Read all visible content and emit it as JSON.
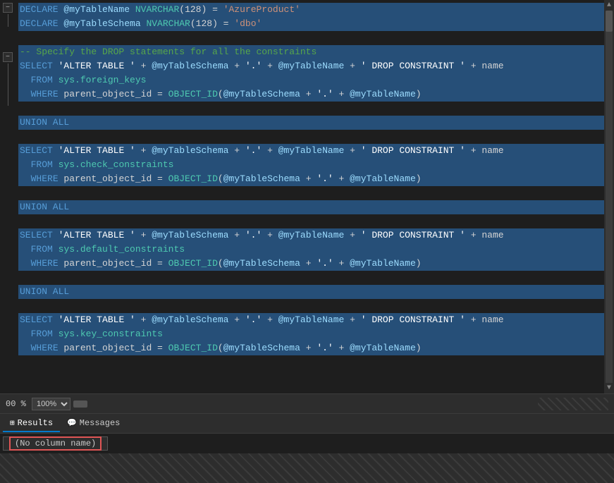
{
  "editor": {
    "lines": [
      {
        "id": 1,
        "selected": true,
        "collapse": true,
        "content": "line1"
      },
      {
        "id": 2,
        "selected": true,
        "collapse": false,
        "content": "line2"
      },
      {
        "id": 3,
        "selected": false,
        "collapse": false,
        "content": "blank1"
      },
      {
        "id": 4,
        "selected": true,
        "collapse": false,
        "content": "comment1"
      },
      {
        "id": 5,
        "selected": true,
        "collapse": true,
        "content": "select1"
      },
      {
        "id": 6,
        "selected": true,
        "collapse": false,
        "content": "from1"
      },
      {
        "id": 7,
        "selected": true,
        "collapse": false,
        "content": "where1"
      },
      {
        "id": 8,
        "selected": false,
        "collapse": false,
        "content": "blank2"
      },
      {
        "id": 9,
        "selected": true,
        "collapse": false,
        "content": "union1"
      },
      {
        "id": 10,
        "selected": false,
        "collapse": false,
        "content": "blank3"
      },
      {
        "id": 11,
        "selected": true,
        "collapse": false,
        "content": "select2"
      },
      {
        "id": 12,
        "selected": true,
        "collapse": false,
        "content": "from2"
      },
      {
        "id": 13,
        "selected": true,
        "collapse": false,
        "content": "where2"
      },
      {
        "id": 14,
        "selected": false,
        "collapse": false,
        "content": "blank4"
      },
      {
        "id": 15,
        "selected": true,
        "collapse": false,
        "content": "union2"
      },
      {
        "id": 16,
        "selected": false,
        "collapse": false,
        "content": "blank5"
      },
      {
        "id": 17,
        "selected": true,
        "collapse": false,
        "content": "select3"
      },
      {
        "id": 18,
        "selected": true,
        "collapse": false,
        "content": "from3"
      },
      {
        "id": 19,
        "selected": true,
        "collapse": false,
        "content": "where3"
      },
      {
        "id": 20,
        "selected": false,
        "collapse": false,
        "content": "blank6"
      },
      {
        "id": 21,
        "selected": true,
        "collapse": false,
        "content": "union3"
      },
      {
        "id": 22,
        "selected": false,
        "collapse": false,
        "content": "blank7"
      },
      {
        "id": 23,
        "selected": true,
        "collapse": false,
        "content": "select4"
      },
      {
        "id": 24,
        "selected": true,
        "collapse": false,
        "content": "from4"
      },
      {
        "id": 25,
        "selected": true,
        "collapse": false,
        "content": "where4"
      }
    ]
  },
  "zoom": {
    "value": "00 %",
    "label": "zoom-level"
  },
  "results": {
    "tabs": [
      {
        "id": "results",
        "label": "Results",
        "icon": "grid",
        "active": true
      },
      {
        "id": "messages",
        "label": "Messages",
        "icon": "msg",
        "active": false
      }
    ],
    "column_header": "(No column name)"
  }
}
